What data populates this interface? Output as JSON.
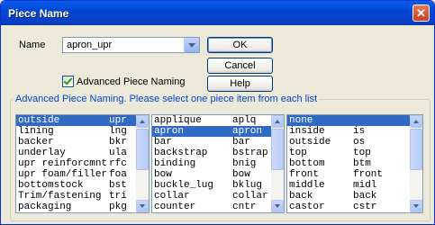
{
  "window": {
    "title": "Piece Name"
  },
  "name_field": {
    "label": "Name",
    "value": "apron_upr"
  },
  "buttons": {
    "ok": "OK",
    "cancel": "Cancel",
    "help": "Help"
  },
  "advanced_checkbox": {
    "label": "Advanced Piece Naming",
    "checked": true
  },
  "group_label": "Advanced Piece Naming.  Please select one piece item from each list",
  "lists": [
    {
      "selected_index": 0,
      "items": [
        [
          "outside",
          "upr"
        ],
        [
          "lining",
          "lng"
        ],
        [
          "backer",
          "bkr"
        ],
        [
          "underlay",
          "ula"
        ],
        [
          "upr reinforcmnt",
          "rfc"
        ],
        [
          "upr foam/filler",
          "foa"
        ],
        [
          "bottomstock",
          "bst"
        ],
        [
          "Trim/fastening",
          "tri"
        ],
        [
          "packaging",
          "pkg"
        ]
      ]
    },
    {
      "selected_index": 1,
      "items": [
        [
          "applique",
          "aplq"
        ],
        [
          "apron",
          "apron"
        ],
        [
          "bar",
          "bar"
        ],
        [
          "backstrap",
          "bstrap"
        ],
        [
          "binding",
          "bnig"
        ],
        [
          "bow",
          "bow"
        ],
        [
          "buckle_lug",
          "bklug"
        ],
        [
          "collar",
          "collar"
        ],
        [
          "counter",
          "cntr"
        ]
      ]
    },
    {
      "selected_index": 0,
      "items": [
        [
          "none",
          ""
        ],
        [
          "inside",
          "is"
        ],
        [
          "outside",
          "os"
        ],
        [
          "top",
          "top"
        ],
        [
          "bottom",
          "btm"
        ],
        [
          "front",
          "front"
        ],
        [
          "middle",
          "midl"
        ],
        [
          "back",
          "back"
        ],
        [
          "castor",
          "cstr"
        ]
      ]
    }
  ],
  "colors": {
    "title_bar": "#0046d5",
    "selection": "#316ac5",
    "group_label": "#0046d5"
  },
  "icons": {
    "close": "close-icon",
    "dropdown": "chevron-down-icon",
    "scroll_up": "scroll-up-arrow-icon",
    "scroll_down": "scroll-down-arrow-icon"
  }
}
